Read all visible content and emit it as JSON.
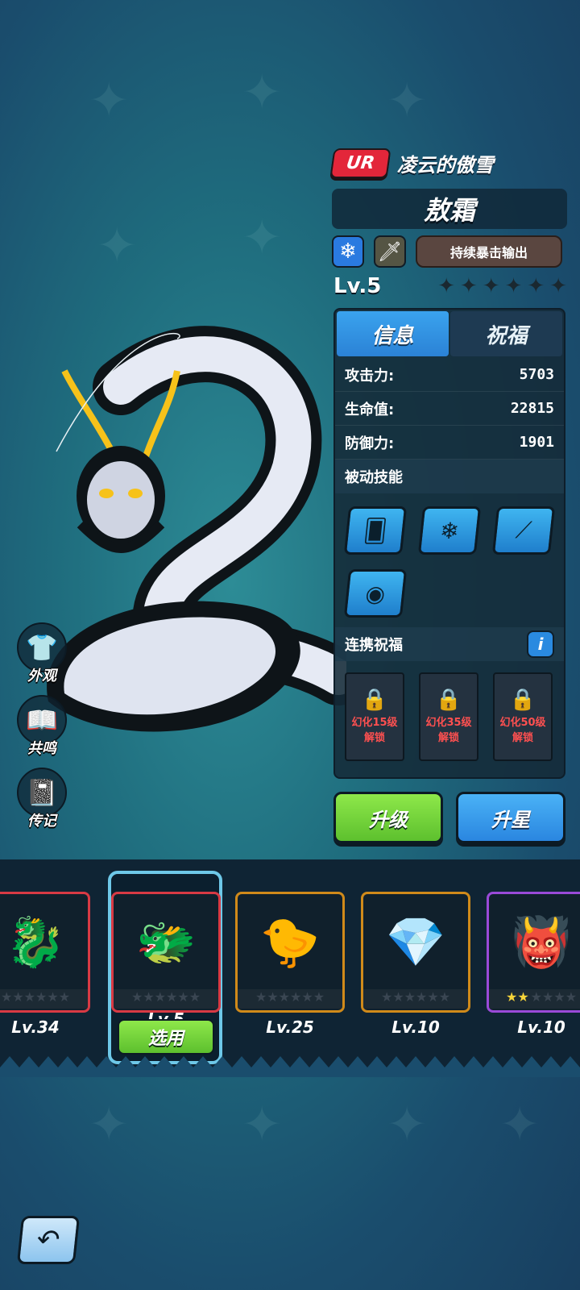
{
  "hero": {
    "rarity": "UR",
    "epithet": "凌云的傲雪",
    "name": "敖霜",
    "element_icon": "snowflake-icon",
    "class_icon": "sword-icon",
    "style_tag": "持续暴击输出",
    "level": "Lv.5",
    "stars_filled": 0,
    "stars_total": 6
  },
  "tabs": [
    {
      "label": "信息",
      "active": true
    },
    {
      "label": "祝福",
      "active": false
    }
  ],
  "stats": [
    {
      "label": "攻击力:",
      "value": "5703"
    },
    {
      "label": "生命值:",
      "value": "22815"
    },
    {
      "label": "防御力:",
      "value": "1901"
    }
  ],
  "passive_section": {
    "title": "被动技能",
    "skills": [
      "cards-dice-icon",
      "snowflakes-icon",
      "claw-slash-icon",
      "dragon-emblem-icon"
    ]
  },
  "link_blessing": {
    "title": "连携祝福",
    "info_label": "i",
    "locks": [
      {
        "line1": "幻化15级",
        "line2": "解锁"
      },
      {
        "line1": "幻化35级",
        "line2": "解锁"
      },
      {
        "line1": "幻化50级",
        "line2": "解锁"
      }
    ]
  },
  "actions": {
    "upgrade": "升级",
    "star_up": "升星"
  },
  "side_menu": [
    {
      "label": "外观",
      "icon": "shirt-icon"
    },
    {
      "label": "共鸣",
      "icon": "book-icon"
    },
    {
      "label": "传记",
      "icon": "journal-icon"
    }
  ],
  "roster": [
    {
      "level": "Lv.34",
      "border": "#d83a44",
      "art": "green-dragon-icon"
    },
    {
      "level": "Lv.5",
      "border": "#d83a44",
      "art": "white-dragon-icon",
      "selected": true,
      "button": "选用"
    },
    {
      "level": "Lv.25",
      "border": "#d08a1a",
      "art": "yellow-bird-icon"
    },
    {
      "level": "Lv.10",
      "border": "#d08a1a",
      "art": "ice-crystal-icon"
    },
    {
      "level": "Lv.10",
      "border": "#9a4ad8",
      "art": "red-beast-icon",
      "stars_filled": 2
    }
  ],
  "colors": {
    "ur_badge": "#e3263a",
    "tab_active": "#2b82d6",
    "upgrade_green": "#5dc02e",
    "star_blue": "#2a86e0",
    "lock_text": "#ff5050"
  }
}
